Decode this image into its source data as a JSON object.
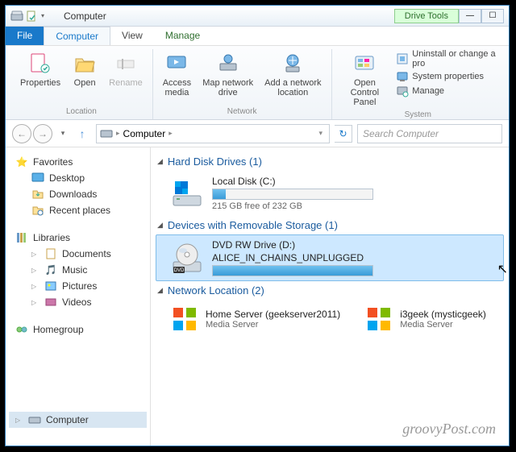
{
  "title": "Computer",
  "drive_tools": "Drive Tools",
  "menu": {
    "file": "File",
    "computer": "Computer",
    "view": "View",
    "manage": "Manage"
  },
  "ribbon": {
    "properties": "Properties",
    "open": "Open",
    "rename": "Rename",
    "access": "Access\nmedia",
    "mapnet": "Map network\ndrive",
    "addnet": "Add a network\nlocation",
    "opencp": "Open Control\nPanel",
    "uninstall": "Uninstall or change a pro",
    "sysprops": "System properties",
    "manage": "Manage",
    "grp_location": "Location",
    "grp_network": "Network",
    "grp_system": "System"
  },
  "breadcrumb": {
    "root": "Computer"
  },
  "search_placeholder": "Search Computer",
  "nav": {
    "favorites": "Favorites",
    "desktop": "Desktop",
    "downloads": "Downloads",
    "recent": "Recent places",
    "libraries": "Libraries",
    "documents": "Documents",
    "music": "Music",
    "pictures": "Pictures",
    "videos": "Videos",
    "homegroup": "Homegroup",
    "computer": "Computer"
  },
  "groups": {
    "hdd": "Hard Disk Drives (1)",
    "removable": "Devices with Removable Storage (1)",
    "network": "Network Location (2)"
  },
  "local_disk": {
    "name": "Local Disk (C:)",
    "free": "215 GB free of 232 GB",
    "fill_pct": 8
  },
  "dvd": {
    "name": "DVD RW Drive (D:)",
    "label": "ALICE_IN_CHAINS_UNPLUGGED",
    "fill_pct": 100,
    "badge": "DVD"
  },
  "net1": {
    "name": "Home Server (geekserver2011)",
    "sub": "Media Server"
  },
  "net2": {
    "name": "i3geek (mysticgeek)",
    "sub": "Media Server"
  },
  "watermark": "groovyPost.com"
}
